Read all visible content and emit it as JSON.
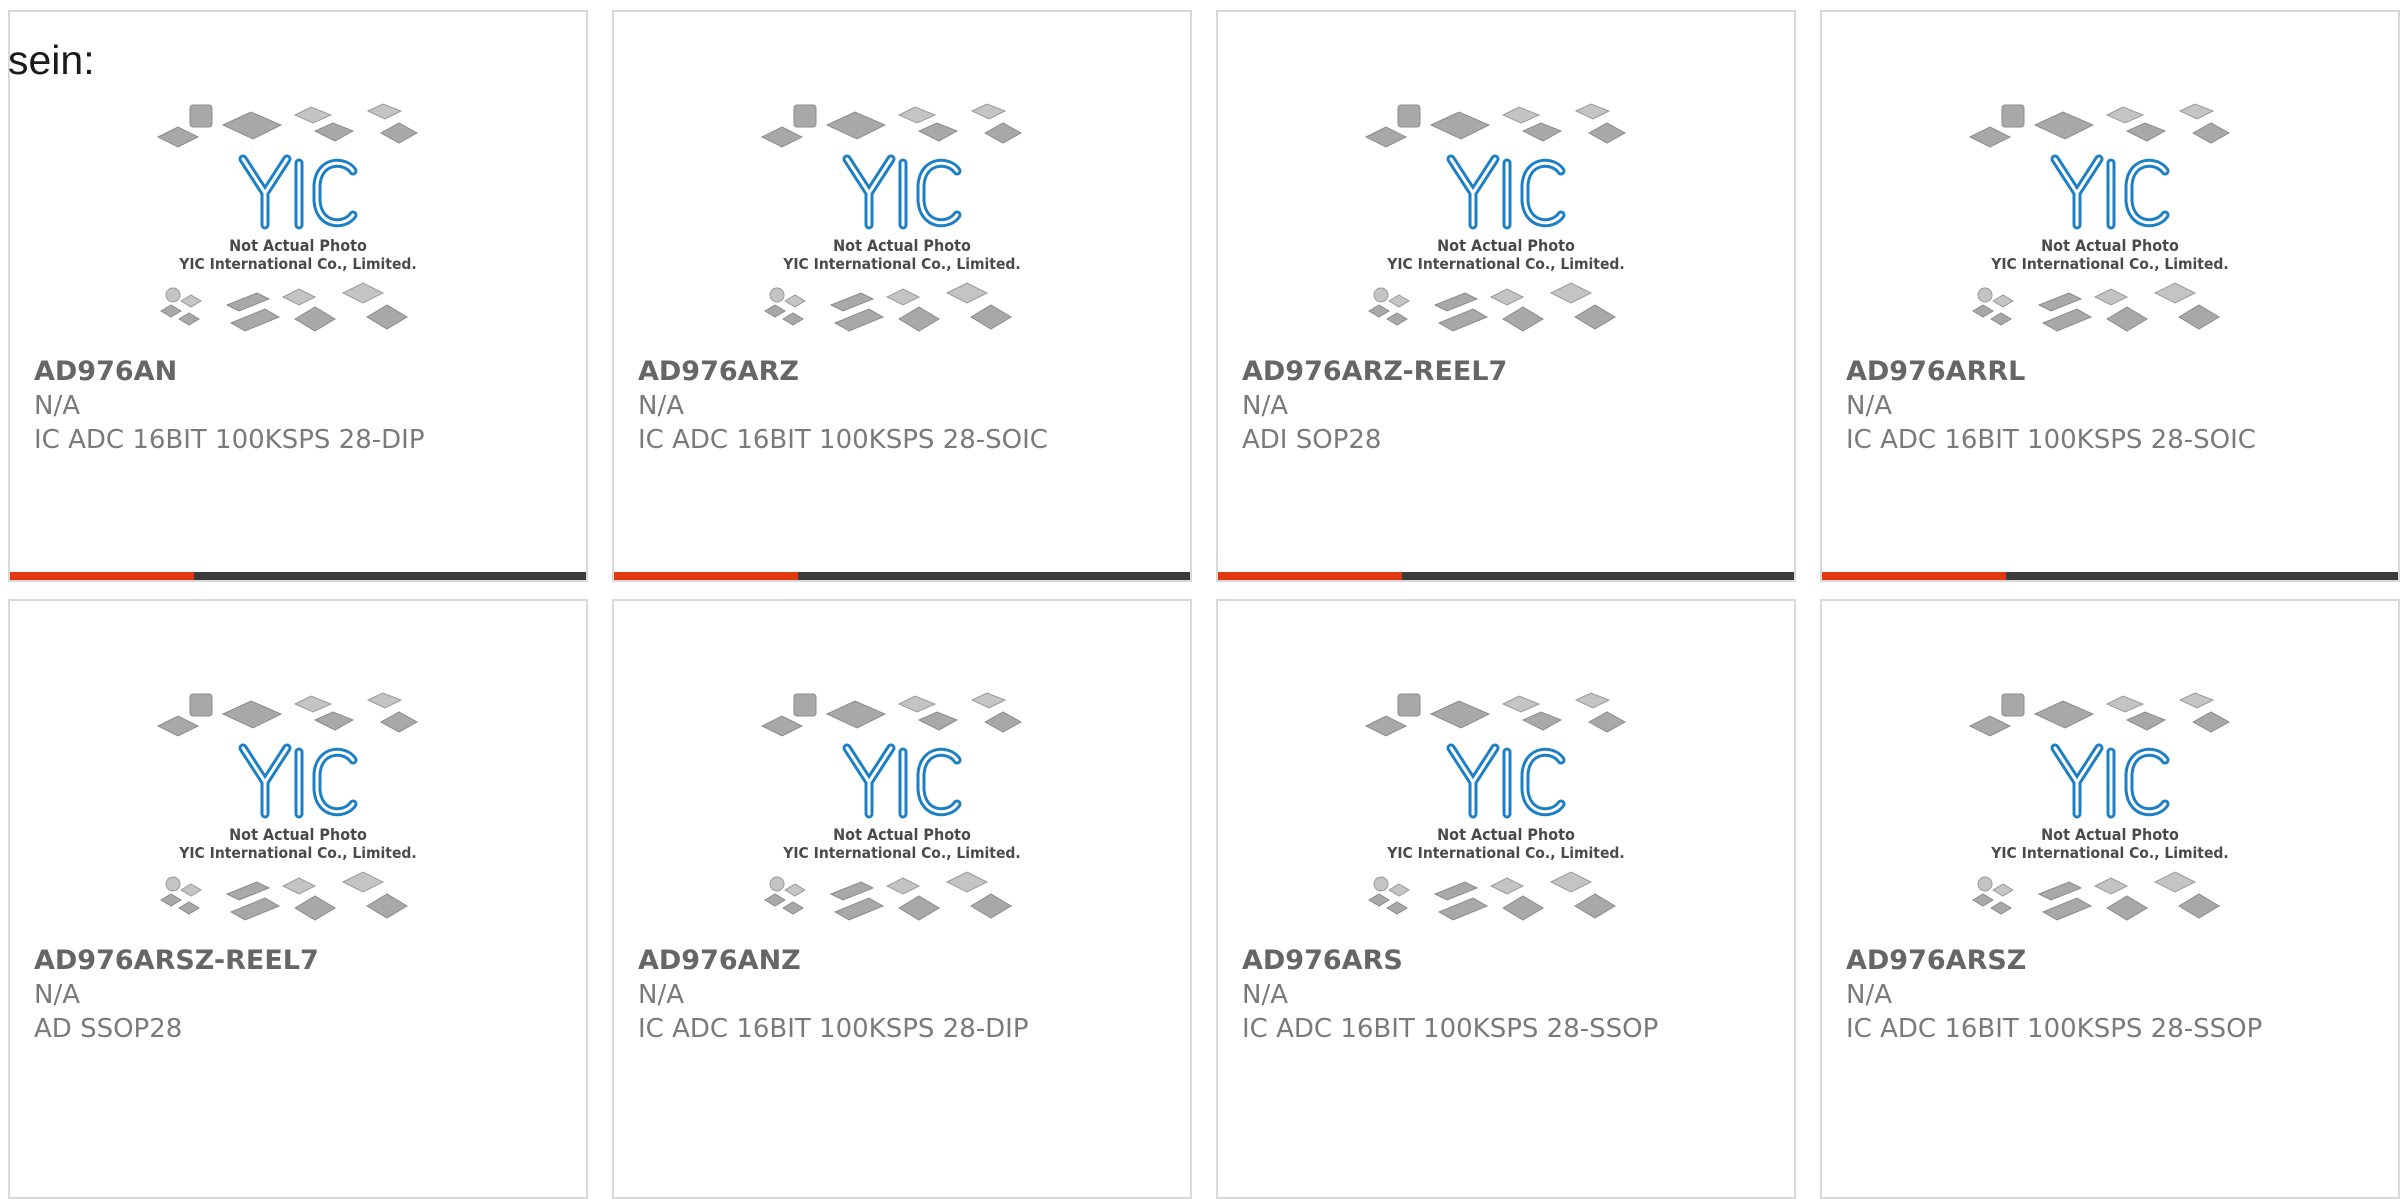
{
  "intro_text": "sein:",
  "placeholder": {
    "line1": "Not Actual Photo",
    "line2": "YIC International Co., Limited.",
    "brand": "YIC"
  },
  "colors": {
    "accent": "#e23a10",
    "track": "#3b3b3b",
    "logo": "#1d7fc4",
    "border": "#d9d9d9"
  },
  "products": [
    {
      "part": "AD976AN",
      "manufacturer": "N/A",
      "description": "IC ADC 16BIT 100KSPS 28-DIP",
      "progress": 0.32
    },
    {
      "part": "AD976ARZ",
      "manufacturer": "N/A",
      "description": "IC ADC 16BIT 100KSPS 28-SOIC",
      "progress": 0.32
    },
    {
      "part": "AD976ARZ-REEL7",
      "manufacturer": "N/A",
      "description": "ADI SOP28",
      "progress": 0.32
    },
    {
      "part": "AD976ARRL",
      "manufacturer": "N/A",
      "description": "IC ADC 16BIT 100KSPS 28-SOIC",
      "progress": 0.32
    },
    {
      "part": "AD976ARSZ-REEL7",
      "manufacturer": "N/A",
      "description": "AD SSOP28",
      "progress": null
    },
    {
      "part": "AD976ANZ",
      "manufacturer": "N/A",
      "description": "IC ADC 16BIT 100KSPS 28-DIP",
      "progress": null
    },
    {
      "part": "AD976ARS",
      "manufacturer": "N/A",
      "description": "IC ADC 16BIT 100KSPS 28-SSOP",
      "progress": null
    },
    {
      "part": "AD976ARSZ",
      "manufacturer": "N/A",
      "description": "IC ADC 16BIT 100KSPS 28-SSOP",
      "progress": null
    }
  ]
}
